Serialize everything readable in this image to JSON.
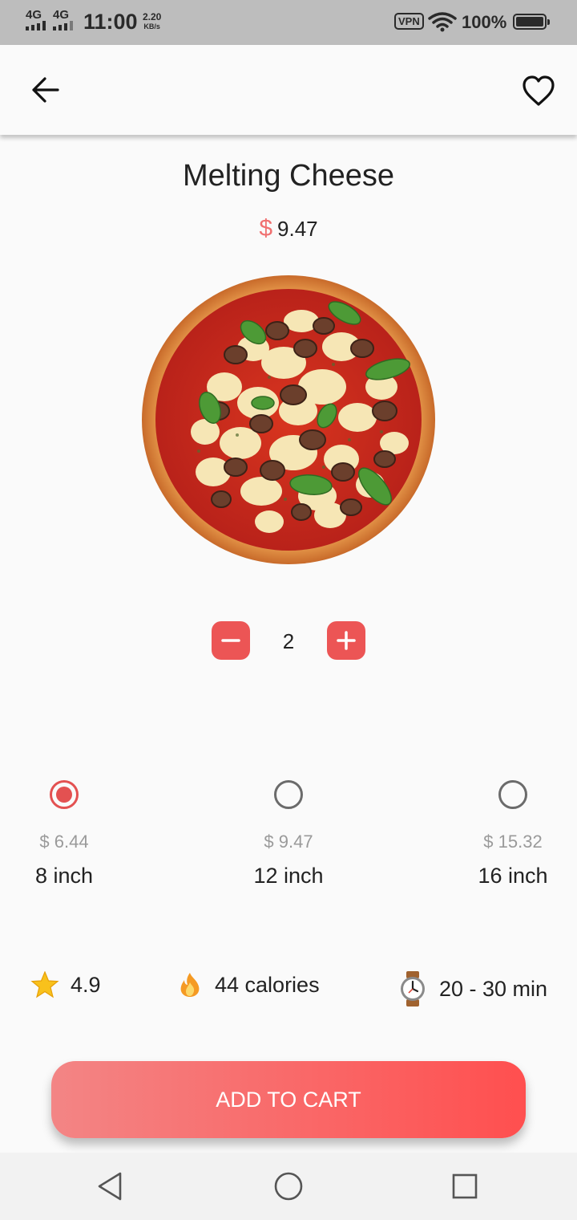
{
  "status_bar": {
    "net1": "4G",
    "net2": "4G",
    "time": "11:00",
    "speed_value": "2.20",
    "speed_unit": "KB/s",
    "vpn": "VPN",
    "battery": "100%"
  },
  "app_bar": {
    "back_icon": "arrow-left-icon",
    "favorite_icon": "heart-outline-icon"
  },
  "product": {
    "name": "Melting Cheese",
    "currency_symbol": "$",
    "price": "9.47",
    "image_icon": "pizza-image"
  },
  "quantity": {
    "value": "2",
    "minus_icon": "minus-icon",
    "plus_icon": "plus-icon"
  },
  "sizes": [
    {
      "price": "$ 6.44",
      "label": "8 inch",
      "selected": true
    },
    {
      "price": "$ 9.47",
      "label": "12 inch",
      "selected": false
    },
    {
      "price": "$ 15.32",
      "label": "16 inch",
      "selected": false
    }
  ],
  "info": {
    "rating": "4.9",
    "calories": "44 calories",
    "time": "20 - 30 min"
  },
  "cart": {
    "label": "ADD TO CART"
  },
  "colors": {
    "accent": "#ec5555",
    "button_gradient_start": "#f38585",
    "button_gradient_end": "#ff4f4f",
    "price_gray": "#9a9a9a"
  },
  "nav": {
    "back_icon": "nav-back-triangle-icon",
    "home_icon": "nav-home-circle-icon",
    "recents_icon": "nav-recents-square-icon"
  }
}
